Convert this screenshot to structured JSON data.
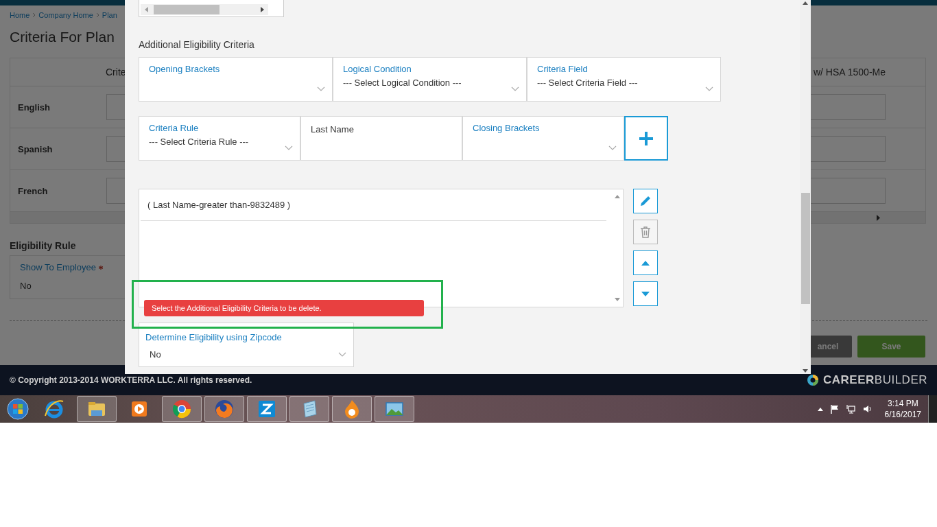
{
  "page": {
    "breadcrumb": [
      "Home",
      "Company Home",
      "Plan"
    ],
    "title": "Criteria For Plan",
    "table": {
      "columns": [
        "Crite",
        "w/ HSA 1500-Me"
      ],
      "rows": [
        "English",
        "Spanish",
        "French"
      ]
    },
    "eligibility_rule": {
      "heading": "Eligibility Rule",
      "field": {
        "label": "Show To Employee",
        "required": true,
        "value": "No"
      }
    },
    "buttons": [
      {
        "label": "ancel",
        "kind": "cancel"
      },
      {
        "label": "Save",
        "kind": "save"
      }
    ]
  },
  "footer": {
    "copyright": "© Copyright 2013-2014 WORKTERRA LLC. All rights reserved.",
    "brand": "**CAREER**BUILDER"
  },
  "dialog": {
    "heading": "Additional Eligibility Criteria",
    "fields": [
      [
        {
          "kind": "select",
          "label": "Opening Brackets"
        },
        {
          "kind": "select",
          "label": "Logical Condition",
          "value": "--- Select Logical Condition ---"
        },
        {
          "kind": "select",
          "label": "Criteria Field",
          "value": "--- Select Criteria Field ---"
        }
      ],
      [
        {
          "kind": "select",
          "label": "Criteria Rule",
          "value": "--- Select Criteria Rule ---"
        },
        {
          "kind": "text",
          "value": "Last Name"
        },
        {
          "kind": "select",
          "label": "Closing Brackets"
        }
      ]
    ],
    "criteria_list": [
      "( Last Name-greater than-9832489 )"
    ],
    "list_buttons": [
      {
        "kind": "edit",
        "disabled": false
      },
      {
        "kind": "delete",
        "disabled": true
      },
      {
        "kind": "up",
        "disabled": false
      },
      {
        "kind": "down",
        "disabled": false
      }
    ],
    "error": "Select the Additional Eligibility Criteria to be delete.",
    "zipcode": {
      "label": "Determine Eligibility using Zipcode",
      "value": "No"
    }
  },
  "taskbar": {
    "apps": [
      {
        "kind": "ie",
        "open": false
      },
      {
        "kind": "folder",
        "open": true
      },
      {
        "kind": "media",
        "open": false
      },
      {
        "kind": "chrome",
        "open": true
      },
      {
        "kind": "firefox",
        "open": true
      },
      {
        "kind": "z",
        "open": true
      },
      {
        "kind": "notepad",
        "open": true
      },
      {
        "kind": "flame",
        "open": true
      },
      {
        "kind": "photo",
        "open": true
      }
    ],
    "time": "3:14 PM",
    "date": "6/16/2017"
  }
}
